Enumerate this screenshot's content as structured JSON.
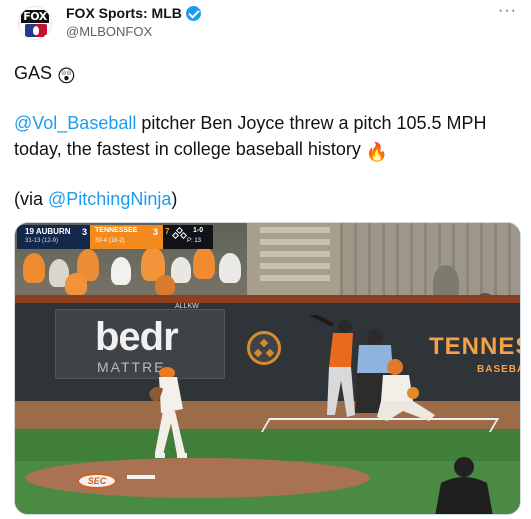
{
  "account": {
    "display_name": "FOX Sports: MLB",
    "handle": "@MLBONFOX",
    "avatar_label": "FOX",
    "verified": true
  },
  "menu": {
    "more_label": "···"
  },
  "tweet": {
    "line1_text": "GAS",
    "line1_emoji": "😲",
    "mention_team": "@Vol_Baseball",
    "body_text": " pitcher Ben Joyce threw a pitch 105.5 MPH today, the fastest in college baseball history",
    "body_emoji": "🔥",
    "via_prefix": "(via ",
    "via_mention": "@PitchingNinja",
    "via_suffix": ")"
  },
  "media": {
    "scorebug": {
      "away_team": "19 AUBURN",
      "away_record": "31-13 (12-9)",
      "away_score": "3",
      "home_team": "TENNESSEE",
      "home_record": "39-4 (18-2)",
      "home_score": "3",
      "inning": "7",
      "count": "1-0",
      "pitch_count": "P: 13"
    },
    "signage": {
      "sponsor_main": "bedr",
      "sponsor_sub": "MATTRE",
      "allkw": "ALLKW",
      "tenn_text": "TENNES",
      "baseball_text": "BASEBA",
      "mound_logo": "SEC"
    },
    "colors": {
      "tennessee_orange": "#f28a20",
      "auburn_navy": "#14284b",
      "link_blue": "#1d9bf0"
    }
  }
}
